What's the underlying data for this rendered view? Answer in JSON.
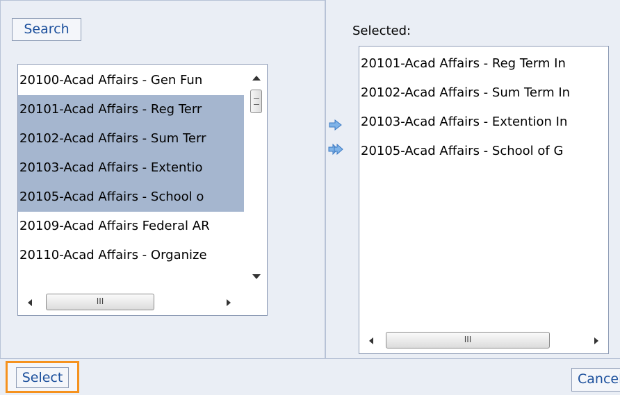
{
  "buttons": {
    "search": "Search",
    "select": "Select",
    "cancel": "Cancel"
  },
  "source_list": {
    "items": [
      {
        "label": "20100-Acad Affairs - Gen Fun",
        "selected": false
      },
      {
        "label": "20101-Acad Affairs - Reg Terr",
        "selected": true
      },
      {
        "label": "20102-Acad Affairs - Sum Terr",
        "selected": true
      },
      {
        "label": "20103-Acad Affairs - Extentio",
        "selected": true
      },
      {
        "label": "20105-Acad Affairs - School o",
        "selected": true
      },
      {
        "label": "20109-Acad Affairs Federal AR",
        "selected": false
      },
      {
        "label": "20110-Acad Affairs - Organize",
        "selected": false
      }
    ]
  },
  "selected_list": {
    "label": "Selected:",
    "items": [
      "20101-Acad Affairs - Reg Term In",
      "20102-Acad Affairs - Sum Term In",
      "20103-Acad Affairs - Extention In",
      "20105-Acad Affairs - School of G"
    ]
  },
  "icons": {
    "move_right": "arrow-right-icon",
    "move_all_right": "double-arrow-right-icon",
    "accent": "#f5921e"
  }
}
